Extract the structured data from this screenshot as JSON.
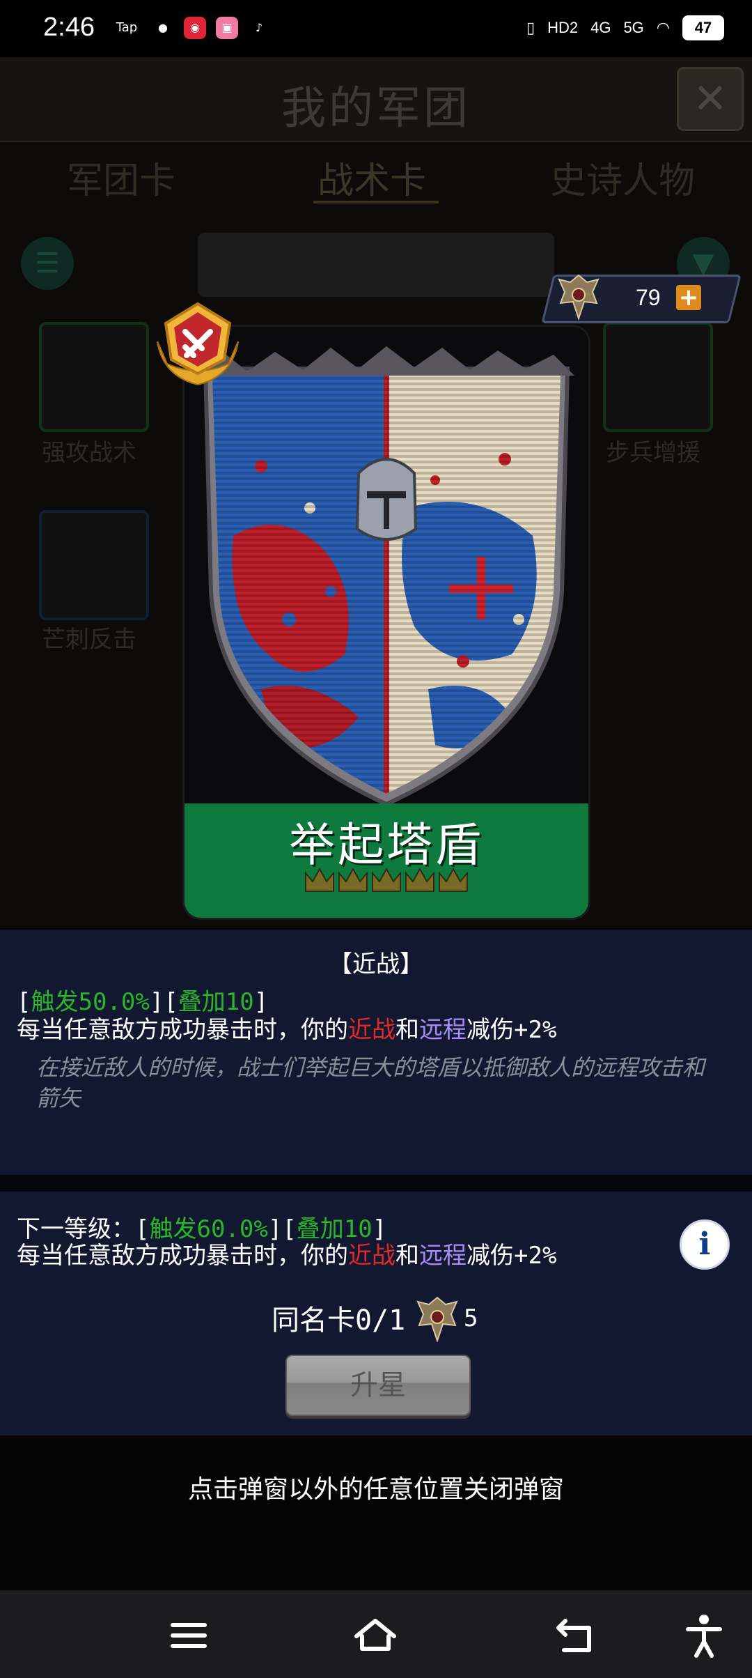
{
  "status": {
    "time": "2:46",
    "apps": [
      "Tap",
      "WeChat",
      "Weibo",
      "Bilibili",
      "TikTok"
    ],
    "network": [
      "HD2",
      "4G",
      "5G"
    ],
    "battery": "47"
  },
  "background_app": {
    "title": "我的军团",
    "tabs": [
      "军团卡",
      "战术卡",
      "史诗人物"
    ],
    "active_tab": 1,
    "cards": [
      "强攻战术",
      "步兵增援",
      "芒刺反击"
    ]
  },
  "currency": {
    "count": "79",
    "plus": "+"
  },
  "card": {
    "name": "举起塔盾",
    "stars": 5
  },
  "details": {
    "category": "【近战】",
    "trigger_prefix": "[",
    "trigger": "触发50.0%",
    "mid": "][",
    "stack": "叠加10",
    "suffix": "]",
    "desc_a": "每当任意敌方成功暴击时，你的",
    "melee": "近战",
    "and": "和",
    "ranged": "远程",
    "desc_b": "减伤+2%",
    "flavor": "在接近敌人的时候，战士们举起巨大的塔盾以抵御敌人的远程攻击和箭矢"
  },
  "next_level": {
    "prefix": "下一等级：[",
    "trigger": "触发60.0%",
    "mid": "][",
    "stack": "叠加10",
    "suffix": "]",
    "desc_a": "每当任意敌方成功暴击时，你的",
    "melee": "近战",
    "and": "和",
    "ranged": "远程",
    "desc_b": "减伤+2%"
  },
  "duplicates": {
    "label": "同名卡0/1",
    "cost": "5"
  },
  "upgrade_button": "升星",
  "close_hint": "点击弹窗以外的任意位置关闭弹窗"
}
